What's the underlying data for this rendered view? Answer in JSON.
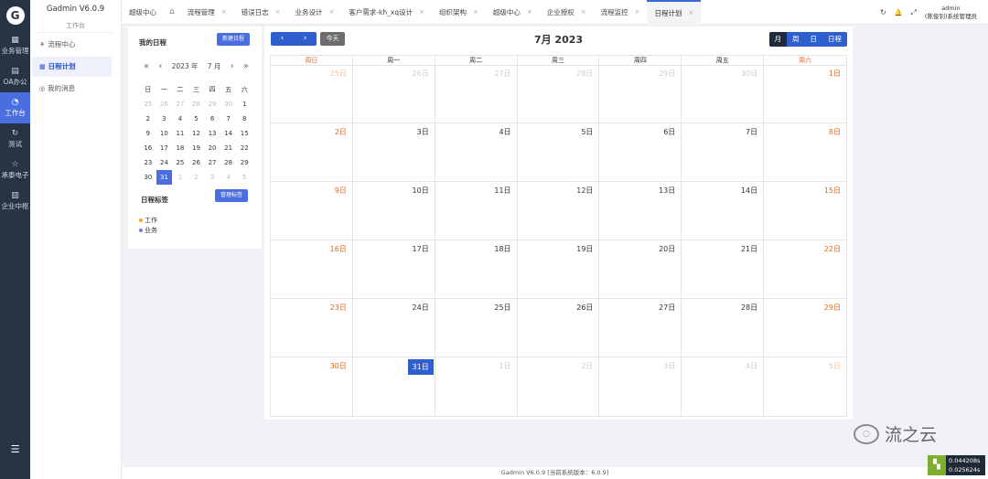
{
  "rail": {
    "items": [
      {
        "icon": "grid-icon",
        "glyph": "▦",
        "label": "业务管理"
      },
      {
        "icon": "doc-icon",
        "glyph": "▤",
        "label": "OA办公"
      },
      {
        "icon": "gauge-icon",
        "glyph": "◔",
        "label": "工作台"
      },
      {
        "icon": "refresh-icon",
        "glyph": "↻",
        "label": "测试"
      },
      {
        "icon": "star-icon",
        "glyph": "☆",
        "label": "承泰电子"
      },
      {
        "icon": "building-icon",
        "glyph": "▥",
        "label": "企业中枢"
      }
    ],
    "logo": "G",
    "toggle": "☰"
  },
  "sidebar": {
    "version": "Gadmin V6.0.9",
    "group": "工作台",
    "items": [
      {
        "glyph": "⚘",
        "label": "流程中心"
      },
      {
        "glyph": "▦",
        "label": "日程计划"
      },
      {
        "glyph": "◎",
        "label": "我的消息"
      }
    ]
  },
  "tabs": {
    "items": [
      {
        "label": "超级中心"
      },
      {
        "label": "⌂"
      },
      {
        "label": "流程管理"
      },
      {
        "label": "错误日志"
      },
      {
        "label": "业务设计"
      },
      {
        "label": "客户需求-kh_xq设计"
      },
      {
        "label": "组织架构"
      },
      {
        "label": "超级中心"
      },
      {
        "label": "企业授权"
      },
      {
        "label": "流程监控"
      },
      {
        "label": "日程计划"
      }
    ],
    "close": "×",
    "refresh": "↻",
    "bell": "🔔",
    "fullscreen": "⤢",
    "user_name": "admin",
    "user_role": "(陈俊钊)系统管理员"
  },
  "mini": {
    "title": "我的日程",
    "new_btn": "新建日程",
    "year": "2023 年",
    "month": "7 月",
    "prev_year": "«",
    "prev_month": "‹",
    "next_month": "›",
    "next_year": "»",
    "weekdays": [
      "日",
      "一",
      "二",
      "三",
      "四",
      "五",
      "六"
    ],
    "days": [
      [
        "25",
        "26",
        "27",
        "28",
        "29",
        "30",
        "1"
      ],
      [
        "2",
        "3",
        "4",
        "5",
        "6",
        "7",
        "8"
      ],
      [
        "9",
        "10",
        "11",
        "12",
        "13",
        "14",
        "15"
      ],
      [
        "16",
        "17",
        "18",
        "19",
        "20",
        "21",
        "22"
      ],
      [
        "23",
        "24",
        "25",
        "26",
        "27",
        "28",
        "29"
      ],
      [
        "30",
        "31",
        "1",
        "2",
        "3",
        "4",
        "5"
      ]
    ],
    "tags_title": "日程标签",
    "manage_btn": "管理标签",
    "tags": [
      {
        "label": "工作",
        "color": "#f5a623"
      },
      {
        "label": "业务",
        "color": "#6c7be0"
      }
    ]
  },
  "calendar": {
    "prev": "‹",
    "next": "›",
    "today": "今天",
    "title": "7月 2023",
    "views": [
      "月",
      "周",
      "日",
      "日程"
    ],
    "weekdays": [
      "周日",
      "周一",
      "周二",
      "周三",
      "周四",
      "周五",
      "周六"
    ],
    "weeks": [
      [
        "25日",
        "26日",
        "27日",
        "28日",
        "29日",
        "30日",
        "1日"
      ],
      [
        "2日",
        "3日",
        "4日",
        "5日",
        "6日",
        "7日",
        "8日"
      ],
      [
        "9日",
        "10日",
        "11日",
        "12日",
        "13日",
        "14日",
        "15日"
      ],
      [
        "16日",
        "17日",
        "18日",
        "19日",
        "20日",
        "21日",
        "22日"
      ],
      [
        "23日",
        "24日",
        "25日",
        "26日",
        "27日",
        "28日",
        "29日"
      ],
      [
        "30日",
        "31日",
        "1日",
        "2日",
        "3日",
        "4日",
        "5日"
      ]
    ],
    "selected_day": "31日"
  },
  "footer": {
    "text": "Gadmin V6.0.9 [当前系统版本：6.0.9]"
  },
  "watermark": {
    "text": "流之云"
  },
  "perf": {
    "v1": "0.044208s",
    "v2": "0.025624s"
  },
  "colors": {
    "accent": "#2f5fcf",
    "weekend": "#e6661e",
    "rail": "#263445"
  }
}
